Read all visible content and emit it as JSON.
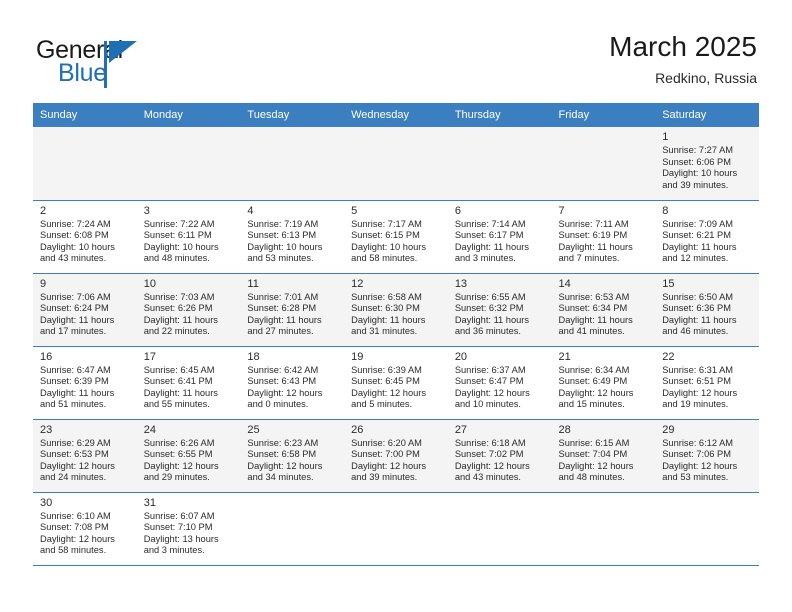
{
  "brand": {
    "name_part1": "General",
    "name_part2": "Blue",
    "accent_color": "#1f6fb5"
  },
  "header": {
    "title": "March 2025",
    "subtitle": "Redkino, Russia"
  },
  "theme": {
    "header_row_bg": "#3c7fc1",
    "alt_row_bg": "#f4f4f4",
    "grid_line": "#3c7fc1"
  },
  "weekdays": [
    "Sunday",
    "Monday",
    "Tuesday",
    "Wednesday",
    "Thursday",
    "Friday",
    "Saturday"
  ],
  "labels": {
    "sunrise": "Sunrise:",
    "sunset": "Sunset:",
    "daylight": "Daylight:"
  },
  "weeks": [
    [
      {
        "empty": true
      },
      {
        "empty": true
      },
      {
        "empty": true
      },
      {
        "empty": true
      },
      {
        "empty": true
      },
      {
        "empty": true
      },
      {
        "day": "1",
        "sunrise": "Sunrise: 7:27 AM",
        "sunset": "Sunset: 6:06 PM",
        "daylight1": "Daylight: 10 hours",
        "daylight2": "and 39 minutes."
      }
    ],
    [
      {
        "day": "2",
        "sunrise": "Sunrise: 7:24 AM",
        "sunset": "Sunset: 6:08 PM",
        "daylight1": "Daylight: 10 hours",
        "daylight2": "and 43 minutes."
      },
      {
        "day": "3",
        "sunrise": "Sunrise: 7:22 AM",
        "sunset": "Sunset: 6:11 PM",
        "daylight1": "Daylight: 10 hours",
        "daylight2": "and 48 minutes."
      },
      {
        "day": "4",
        "sunrise": "Sunrise: 7:19 AM",
        "sunset": "Sunset: 6:13 PM",
        "daylight1": "Daylight: 10 hours",
        "daylight2": "and 53 minutes."
      },
      {
        "day": "5",
        "sunrise": "Sunrise: 7:17 AM",
        "sunset": "Sunset: 6:15 PM",
        "daylight1": "Daylight: 10 hours",
        "daylight2": "and 58 minutes."
      },
      {
        "day": "6",
        "sunrise": "Sunrise: 7:14 AM",
        "sunset": "Sunset: 6:17 PM",
        "daylight1": "Daylight: 11 hours",
        "daylight2": "and 3 minutes."
      },
      {
        "day": "7",
        "sunrise": "Sunrise: 7:11 AM",
        "sunset": "Sunset: 6:19 PM",
        "daylight1": "Daylight: 11 hours",
        "daylight2": "and 7 minutes."
      },
      {
        "day": "8",
        "sunrise": "Sunrise: 7:09 AM",
        "sunset": "Sunset: 6:21 PM",
        "daylight1": "Daylight: 11 hours",
        "daylight2": "and 12 minutes."
      }
    ],
    [
      {
        "day": "9",
        "sunrise": "Sunrise: 7:06 AM",
        "sunset": "Sunset: 6:24 PM",
        "daylight1": "Daylight: 11 hours",
        "daylight2": "and 17 minutes."
      },
      {
        "day": "10",
        "sunrise": "Sunrise: 7:03 AM",
        "sunset": "Sunset: 6:26 PM",
        "daylight1": "Daylight: 11 hours",
        "daylight2": "and 22 minutes."
      },
      {
        "day": "11",
        "sunrise": "Sunrise: 7:01 AM",
        "sunset": "Sunset: 6:28 PM",
        "daylight1": "Daylight: 11 hours",
        "daylight2": "and 27 minutes."
      },
      {
        "day": "12",
        "sunrise": "Sunrise: 6:58 AM",
        "sunset": "Sunset: 6:30 PM",
        "daylight1": "Daylight: 11 hours",
        "daylight2": "and 31 minutes."
      },
      {
        "day": "13",
        "sunrise": "Sunrise: 6:55 AM",
        "sunset": "Sunset: 6:32 PM",
        "daylight1": "Daylight: 11 hours",
        "daylight2": "and 36 minutes."
      },
      {
        "day": "14",
        "sunrise": "Sunrise: 6:53 AM",
        "sunset": "Sunset: 6:34 PM",
        "daylight1": "Daylight: 11 hours",
        "daylight2": "and 41 minutes."
      },
      {
        "day": "15",
        "sunrise": "Sunrise: 6:50 AM",
        "sunset": "Sunset: 6:36 PM",
        "daylight1": "Daylight: 11 hours",
        "daylight2": "and 46 minutes."
      }
    ],
    [
      {
        "day": "16",
        "sunrise": "Sunrise: 6:47 AM",
        "sunset": "Sunset: 6:39 PM",
        "daylight1": "Daylight: 11 hours",
        "daylight2": "and 51 minutes."
      },
      {
        "day": "17",
        "sunrise": "Sunrise: 6:45 AM",
        "sunset": "Sunset: 6:41 PM",
        "daylight1": "Daylight: 11 hours",
        "daylight2": "and 55 minutes."
      },
      {
        "day": "18",
        "sunrise": "Sunrise: 6:42 AM",
        "sunset": "Sunset: 6:43 PM",
        "daylight1": "Daylight: 12 hours",
        "daylight2": "and 0 minutes."
      },
      {
        "day": "19",
        "sunrise": "Sunrise: 6:39 AM",
        "sunset": "Sunset: 6:45 PM",
        "daylight1": "Daylight: 12 hours",
        "daylight2": "and 5 minutes."
      },
      {
        "day": "20",
        "sunrise": "Sunrise: 6:37 AM",
        "sunset": "Sunset: 6:47 PM",
        "daylight1": "Daylight: 12 hours",
        "daylight2": "and 10 minutes."
      },
      {
        "day": "21",
        "sunrise": "Sunrise: 6:34 AM",
        "sunset": "Sunset: 6:49 PM",
        "daylight1": "Daylight: 12 hours",
        "daylight2": "and 15 minutes."
      },
      {
        "day": "22",
        "sunrise": "Sunrise: 6:31 AM",
        "sunset": "Sunset: 6:51 PM",
        "daylight1": "Daylight: 12 hours",
        "daylight2": "and 19 minutes."
      }
    ],
    [
      {
        "day": "23",
        "sunrise": "Sunrise: 6:29 AM",
        "sunset": "Sunset: 6:53 PM",
        "daylight1": "Daylight: 12 hours",
        "daylight2": "and 24 minutes."
      },
      {
        "day": "24",
        "sunrise": "Sunrise: 6:26 AM",
        "sunset": "Sunset: 6:55 PM",
        "daylight1": "Daylight: 12 hours",
        "daylight2": "and 29 minutes."
      },
      {
        "day": "25",
        "sunrise": "Sunrise: 6:23 AM",
        "sunset": "Sunset: 6:58 PM",
        "daylight1": "Daylight: 12 hours",
        "daylight2": "and 34 minutes."
      },
      {
        "day": "26",
        "sunrise": "Sunrise: 6:20 AM",
        "sunset": "Sunset: 7:00 PM",
        "daylight1": "Daylight: 12 hours",
        "daylight2": "and 39 minutes."
      },
      {
        "day": "27",
        "sunrise": "Sunrise: 6:18 AM",
        "sunset": "Sunset: 7:02 PM",
        "daylight1": "Daylight: 12 hours",
        "daylight2": "and 43 minutes."
      },
      {
        "day": "28",
        "sunrise": "Sunrise: 6:15 AM",
        "sunset": "Sunset: 7:04 PM",
        "daylight1": "Daylight: 12 hours",
        "daylight2": "and 48 minutes."
      },
      {
        "day": "29",
        "sunrise": "Sunrise: 6:12 AM",
        "sunset": "Sunset: 7:06 PM",
        "daylight1": "Daylight: 12 hours",
        "daylight2": "and 53 minutes."
      }
    ],
    [
      {
        "day": "30",
        "sunrise": "Sunrise: 6:10 AM",
        "sunset": "Sunset: 7:08 PM",
        "daylight1": "Daylight: 12 hours",
        "daylight2": "and 58 minutes."
      },
      {
        "day": "31",
        "sunrise": "Sunrise: 6:07 AM",
        "sunset": "Sunset: 7:10 PM",
        "daylight1": "Daylight: 13 hours",
        "daylight2": "and 3 minutes."
      },
      {
        "empty": true
      },
      {
        "empty": true
      },
      {
        "empty": true
      },
      {
        "empty": true
      },
      {
        "empty": true
      }
    ]
  ]
}
